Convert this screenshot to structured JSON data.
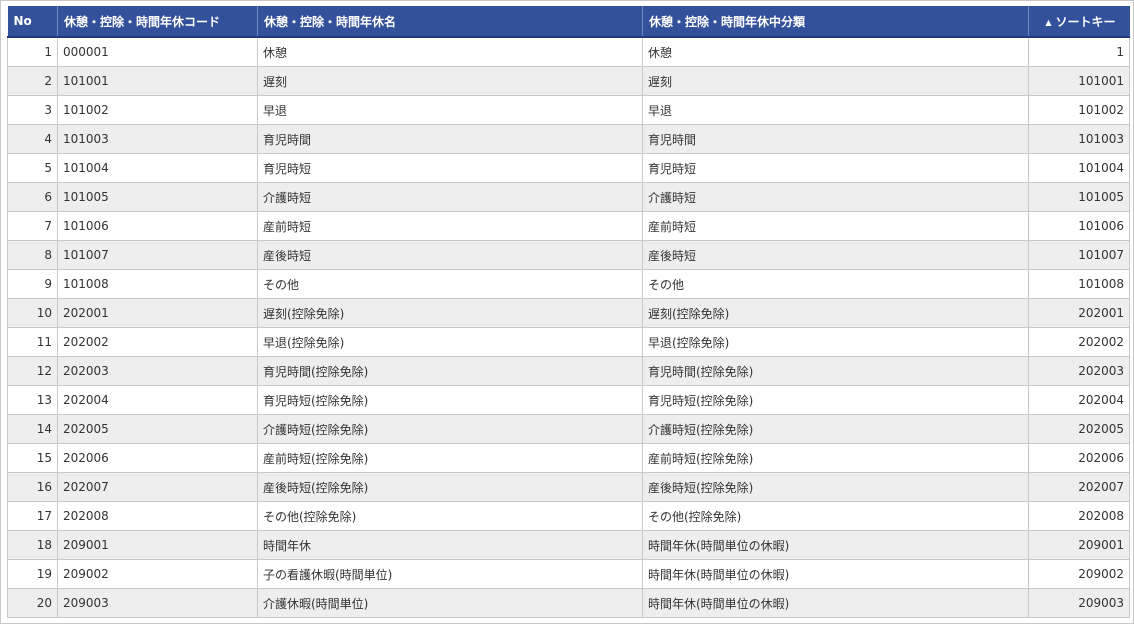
{
  "columns": {
    "no": "No",
    "code": "休憩・控除・時間年休コード",
    "name": "休憩・控除・時間年休名",
    "category": "休憩・控除・時間年休中分類",
    "sort_key": "ソートキー",
    "sorted_column": "sort_key",
    "sort_direction": "ascending"
  },
  "rows": [
    {
      "no": "1",
      "code": "000001",
      "name": "休憩",
      "category": "休憩",
      "sort_key": "1"
    },
    {
      "no": "2",
      "code": "101001",
      "name": "遅刻",
      "category": "遅刻",
      "sort_key": "101001"
    },
    {
      "no": "3",
      "code": "101002",
      "name": "早退",
      "category": "早退",
      "sort_key": "101002"
    },
    {
      "no": "4",
      "code": "101003",
      "name": "育児時間",
      "category": "育児時間",
      "sort_key": "101003"
    },
    {
      "no": "5",
      "code": "101004",
      "name": "育児時短",
      "category": "育児時短",
      "sort_key": "101004"
    },
    {
      "no": "6",
      "code": "101005",
      "name": "介護時短",
      "category": "介護時短",
      "sort_key": "101005"
    },
    {
      "no": "7",
      "code": "101006",
      "name": "産前時短",
      "category": "産前時短",
      "sort_key": "101006"
    },
    {
      "no": "8",
      "code": "101007",
      "name": "産後時短",
      "category": "産後時短",
      "sort_key": "101007"
    },
    {
      "no": "9",
      "code": "101008",
      "name": "その他",
      "category": "その他",
      "sort_key": "101008"
    },
    {
      "no": "10",
      "code": "202001",
      "name": "遅刻(控除免除)",
      "category": "遅刻(控除免除)",
      "sort_key": "202001"
    },
    {
      "no": "11",
      "code": "202002",
      "name": "早退(控除免除)",
      "category": "早退(控除免除)",
      "sort_key": "202002"
    },
    {
      "no": "12",
      "code": "202003",
      "name": "育児時間(控除免除)",
      "category": "育児時間(控除免除)",
      "sort_key": "202003"
    },
    {
      "no": "13",
      "code": "202004",
      "name": "育児時短(控除免除)",
      "category": "育児時短(控除免除)",
      "sort_key": "202004"
    },
    {
      "no": "14",
      "code": "202005",
      "name": "介護時短(控除免除)",
      "category": "介護時短(控除免除)",
      "sort_key": "202005"
    },
    {
      "no": "15",
      "code": "202006",
      "name": "産前時短(控除免除)",
      "category": "産前時短(控除免除)",
      "sort_key": "202006"
    },
    {
      "no": "16",
      "code": "202007",
      "name": "産後時短(控除免除)",
      "category": "産後時短(控除免除)",
      "sort_key": "202007"
    },
    {
      "no": "17",
      "code": "202008",
      "name": "その他(控除免除)",
      "category": "その他(控除免除)",
      "sort_key": "202008"
    },
    {
      "no": "18",
      "code": "209001",
      "name": "時間年休",
      "category": "時間年休(時間単位の休暇)",
      "sort_key": "209001"
    },
    {
      "no": "19",
      "code": "209002",
      "name": "子の看護休暇(時間単位)",
      "category": "時間年休(時間単位の休暇)",
      "sort_key": "209002"
    },
    {
      "no": "20",
      "code": "209003",
      "name": "介護休暇(時間単位)",
      "category": "時間年休(時間単位の休暇)",
      "sort_key": "209003"
    }
  ],
  "colors": {
    "header_bg": "#33509a",
    "header_text": "#ffffff",
    "row_alt_bg": "#eeeeee",
    "border": "#c9c9c9"
  },
  "icons": {
    "sort": "sort-ascending-icon"
  }
}
